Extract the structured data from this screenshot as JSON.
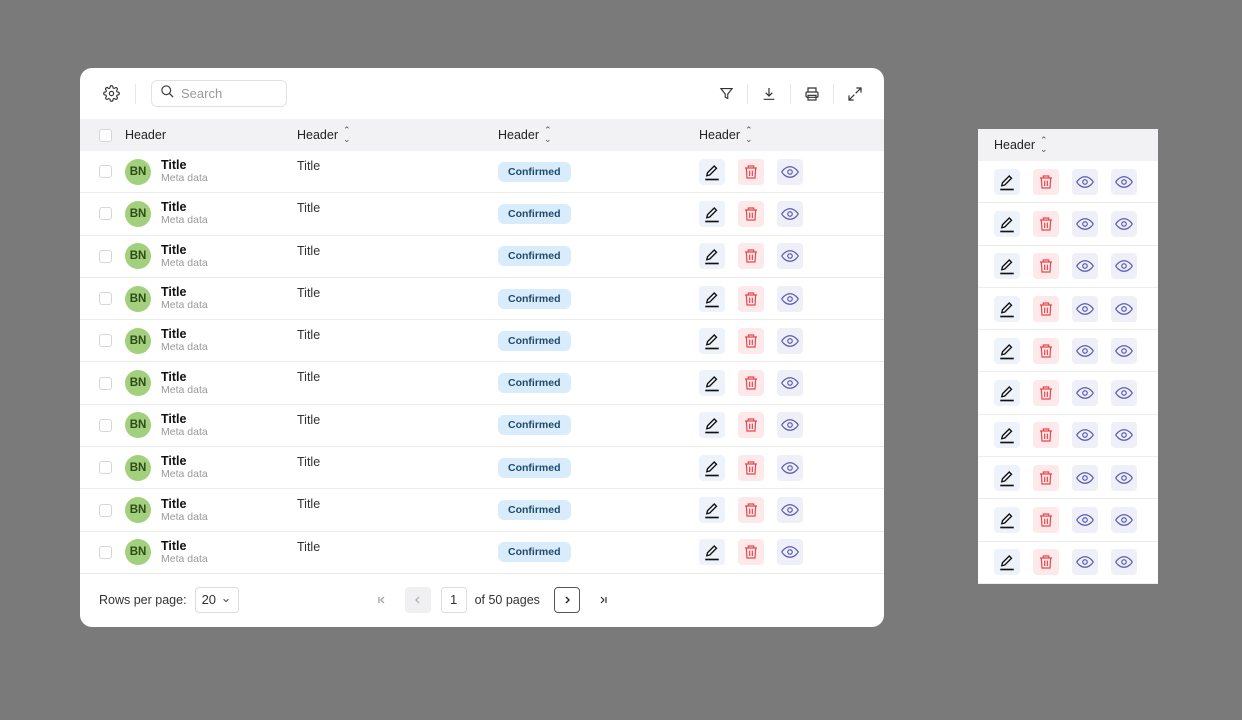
{
  "toolbar": {
    "settings_icon": "gear-icon",
    "search_placeholder": "Search",
    "search_value": "",
    "right_icons": [
      "filter-icon",
      "download-icon",
      "print-icon",
      "expand-icon"
    ]
  },
  "table": {
    "headers": [
      "Header",
      "Header",
      "Header",
      "Header"
    ],
    "rows": [
      {
        "avatar": "BN",
        "title": "Title",
        "meta": "Meta data",
        "col2": "Title",
        "status": "Confirmed"
      },
      {
        "avatar": "BN",
        "title": "Title",
        "meta": "Meta data",
        "col2": "Title",
        "status": "Confirmed"
      },
      {
        "avatar": "BN",
        "title": "Title",
        "meta": "Meta data",
        "col2": "Title",
        "status": "Confirmed"
      },
      {
        "avatar": "BN",
        "title": "Title",
        "meta": "Meta data",
        "col2": "Title",
        "status": "Confirmed"
      },
      {
        "avatar": "BN",
        "title": "Title",
        "meta": "Meta data",
        "col2": "Title",
        "status": "Confirmed"
      },
      {
        "avatar": "BN",
        "title": "Title",
        "meta": "Meta data",
        "col2": "Title",
        "status": "Confirmed"
      },
      {
        "avatar": "BN",
        "title": "Title",
        "meta": "Meta data",
        "col2": "Title",
        "status": "Confirmed"
      },
      {
        "avatar": "BN",
        "title": "Title",
        "meta": "Meta data",
        "col2": "Title",
        "status": "Confirmed"
      },
      {
        "avatar": "BN",
        "title": "Title",
        "meta": "Meta data",
        "col2": "Title",
        "status": "Confirmed"
      },
      {
        "avatar": "BN",
        "title": "Title",
        "meta": "Meta data",
        "col2": "Title",
        "status": "Confirmed"
      }
    ],
    "row_actions": [
      "edit",
      "delete",
      "view"
    ]
  },
  "footer": {
    "rows_per_page_label": "Rows per page:",
    "rows_per_page_value": "20",
    "current_page": "1",
    "of_pages_label": "of 50 pages"
  },
  "side_panel": {
    "header": "Header",
    "row_count": 10,
    "row_actions": [
      "edit",
      "delete",
      "view",
      "view"
    ]
  },
  "colors": {
    "avatar_bg": "#a3d07c",
    "badge_bg": "#d9ecfb",
    "delete_red": "#e5484d",
    "view_purple": "#5b5bb5",
    "header_bg": "#f2f2f4"
  }
}
